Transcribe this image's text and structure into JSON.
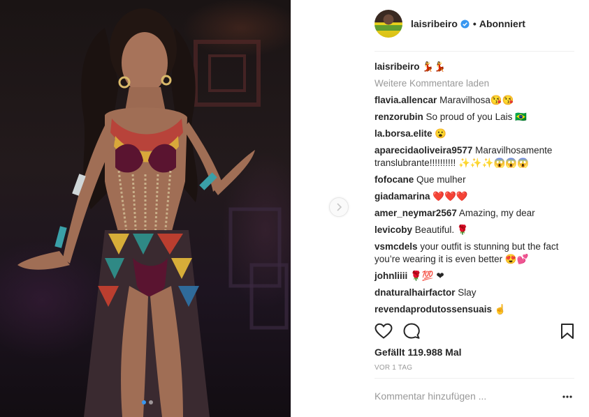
{
  "post": {
    "username": "laisribeiro",
    "follow_status": "Abonniert",
    "bullet": "•",
    "caption_user": "laisribeiro",
    "caption_text": "💃💃",
    "load_more": "Weitere Kommentare laden",
    "likes": "Gefällt 119.988 Mal",
    "time": "VOR 1 TAG",
    "comment_placeholder": "Kommentar hinzufügen ..."
  },
  "comments": [
    {
      "user": "flavia.allencar",
      "text": "Maravilhosa😘😘"
    },
    {
      "user": "renzorubin",
      "text": "So proud of you Lais 🇧🇷"
    },
    {
      "user": "la.borsa.elite",
      "text": "😮"
    },
    {
      "user": "aparecidaoliveira9577",
      "text": "Maravilhosamente translubrante!!!!!!!!!! ✨✨✨😱😱😱"
    },
    {
      "user": "fofocane",
      "text": "Que mulher"
    },
    {
      "user": "giadamarina",
      "text": "❤️❤️❤️"
    },
    {
      "user": "amer_neymar2567",
      "text": "Amazing, my dear"
    },
    {
      "user": "levicoby",
      "text": "Beautiful. 🌹"
    },
    {
      "user": "vsmcdels",
      "text": "your outfit is stunning but the fact you’re wearing it is even better 😍💕"
    },
    {
      "user": "johnliiii",
      "text": "🌹💯 ❤"
    },
    {
      "user": "dnaturalhairfactor",
      "text": "Slay"
    },
    {
      "user": "revendaprodutossensuais",
      "text": "☝"
    }
  ],
  "icons": {
    "like": "heart-icon",
    "comment": "comment-bubble-icon",
    "save": "bookmark-icon",
    "verified": "verified-badge-icon",
    "next": "chevron-right-icon",
    "more": "more-options-icon"
  },
  "carousel": {
    "current": 1,
    "total": 2
  },
  "colors": {
    "accent": "#3897f0",
    "text": "#262626",
    "muted": "#999999",
    "border": "#efefef"
  }
}
